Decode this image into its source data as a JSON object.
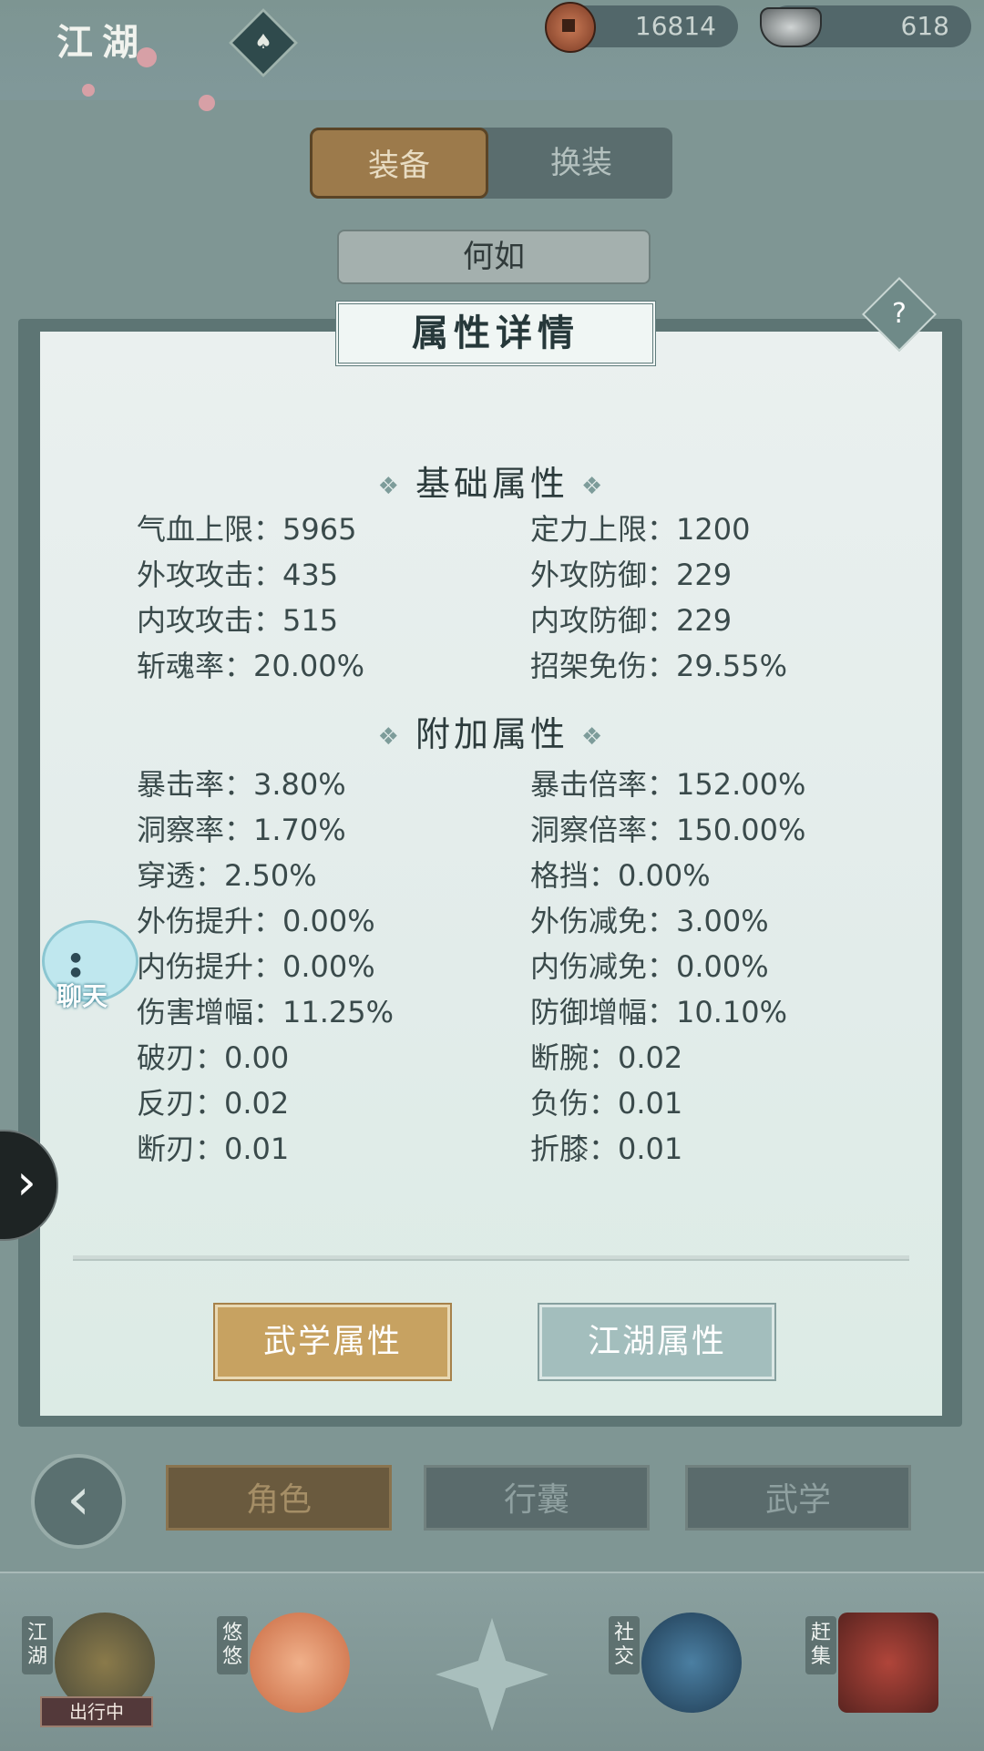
{
  "header": {
    "title": "江湖",
    "title_badge": "♠"
  },
  "currency": [
    {
      "icon": "copper-coin-icon",
      "value": "16814"
    },
    {
      "icon": "silver-ingot-icon",
      "value": "618"
    }
  ],
  "tabs": [
    {
      "label": "装备"
    },
    {
      "label": "换装"
    }
  ],
  "character": {
    "name": "何如"
  },
  "panel": {
    "title": "属性详情",
    "help": "?",
    "basic": {
      "title": "基础属性",
      "stats": [
        "气血上限：5965",
        "定力上限：1200",
        "外攻攻击：435",
        "外攻防御：229",
        "内攻攻击：515",
        "内攻防御：229",
        "斩魂率：20.00%",
        "招架免伤：29.55%"
      ]
    },
    "extra": {
      "title": "附加属性",
      "stats": [
        "暴击率：3.80%",
        "暴击倍率：152.00%",
        "洞察率：1.70%",
        "洞察倍率：150.00%",
        "穿透：2.50%",
        "格挡：0.00%",
        "外伤提升：0.00%",
        "外伤减免：3.00%",
        "内伤提升：0.00%",
        "内伤减免：0.00%",
        "伤害增幅：11.25%",
        "防御增幅：10.10%",
        "破刃：0.00",
        "断腕：0.02",
        "反刃：0.02",
        "负伤：0.01",
        "断刃：0.01",
        "折膝：0.01"
      ]
    },
    "buttons": {
      "martial": "武学属性",
      "jianghu": "江湖属性"
    }
  },
  "chat": {
    "label": "聊天"
  },
  "nav": {
    "back": "‹",
    "role": "角色",
    "bag": "行囊",
    "skill": "武学"
  },
  "dock": [
    {
      "label": "江湖",
      "status": "出行中"
    },
    {
      "label": "悠悠"
    },
    {
      "label": ""
    },
    {
      "label": "社交"
    },
    {
      "label": "赶集"
    }
  ],
  "colors": {
    "accent_gold": "#c7a261",
    "accent_teal": "#a3bebd",
    "panel_bg": "#e2ecea"
  }
}
